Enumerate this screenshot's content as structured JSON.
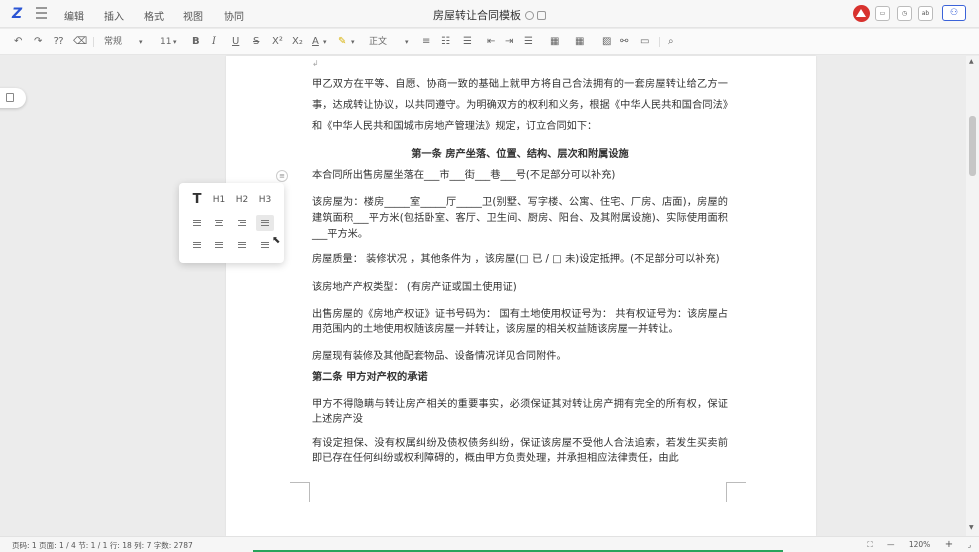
{
  "app": {
    "title": "房屋转让合同模板",
    "menus": [
      "编辑",
      "插入",
      "格式",
      "视图",
      "协同"
    ],
    "share_label": "分享"
  },
  "toolbar": {
    "style": "常规",
    "font_size": "11",
    "bold": "B",
    "italic": "I",
    "underline": "U",
    "strike": "S",
    "superscript": "X²",
    "subscript": "X₂",
    "font_color": "A",
    "paragraph_style": "正文"
  },
  "float_panel": {
    "text": "T",
    "h1": "H1",
    "h2": "H2",
    "h3": "H3"
  },
  "document": {
    "paragraphs": [
      "甲乙双方在平等、自愿、协商一致的基础上就甲方将自己合法拥有的一套房屋转让给乙方一事，达成转让协议，以共同遵守。为明确双方的权利和义务，根据《中华人民共和国合同法》和《中华人民共和国城市房地产管理法》规定，订立合同如下：",
      "第一条 房产坐落、位置、结构、层次和附属设施",
      "本合同所出售房屋坐落在___市___街___巷___号(不足部分可以补充)",
      "该房屋为：楼房_____室_____厅_____卫(别墅、写字楼、公寓、住宅、厂房、店面)，房屋的建筑面积___平方米(包括卧室、客厅、卫生间、厨房、阳台、及其附属设施)、实际使用面积___平方米。",
      "房屋质量： 装修状况 ，其他条件为 ，该房屋(□ 已 / □ 未)设定抵押。(不足部分可以补充)",
      "该房地产产权类型： (有房产证或国土使用证)",
      "出售房屋的《房地产权证》证书号码为： 国有土地使用权证号为： 共有权证号为：该房屋占用范围内的土地使用权随该房屋一并转让，该房屋的相关权益随该房屋一并转让。",
      "房屋现有装修及其他配套物品、设备情况详见合同附件。",
      "第二条 甲方对产权的承诺",
      "甲方不得隐瞒与转让房产相关的重要事实，必须保证其对转让房产拥有完全的所有权，保证上述房产没",
      "有设定担保、没有权属纠纷及债权债务纠纷，保证该房屋不受他人合法追索，若发生买卖前即已存在任何纠纷或权利障碍的，概由甲方负责处理，并承担相应法律责任，由此"
    ]
  },
  "status_bar": {
    "left": "页码: 1  页面: 1 / 4   节: 1 / 1  行: 18  列: 7  字数: 2787",
    "zoom": "120%",
    "minus": "—",
    "plus": "+"
  }
}
